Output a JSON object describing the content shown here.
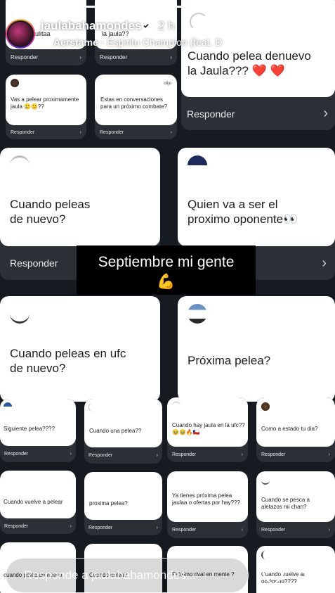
{
  "header": {
    "username": "jaulabahamondes",
    "time_ago": "2 h",
    "music_artist": "Aerstame",
    "music_separator": " · ",
    "music_song": "Espiritu Champion (feat. D",
    "progress_fraction": 0.66
  },
  "caption": {
    "line1": "Septiembre mi gente",
    "emoji": "💪"
  },
  "reply_label": "Responder",
  "reply_input": {
    "placeholder": "Responde a jaulabahamondes..."
  },
  "cards": {
    "r1a": {
      "text_l1": "",
      "text_l2": "jaulitaa",
      "tag": ""
    },
    "r1b": {
      "text_l1": "",
      "text_l2": "la jaula??",
      "tag": ""
    },
    "r1c": {
      "text_l1": "Cuando pelea denuevo",
      "text_l2": "la Jaula??? ❤️ ❤️"
    },
    "r2a": {
      "text": "Vas a pelear proximamente jaula 🥲😕??"
    },
    "r2b": {
      "text": "Estas en conversaciones para un próximo combate?",
      "tag": "olijo"
    },
    "big1": {
      "text_l1": "Cuando peleas",
      "text_l2": "de nuevo?"
    },
    "big2": {
      "text_l1": "Quien va a ser el",
      "text_l2": "proximo oponente👀"
    },
    "big3": {
      "text_l1": "Cuando peleas en ufc",
      "text_l2": "de nuevo?"
    },
    "big4": {
      "text_l1": "Próxima pelea?"
    },
    "s1": {
      "text": "Siguiente pelea????"
    },
    "s2": {
      "text": "Cuando una pelea??"
    },
    "s3": {
      "text": "Cuando hay jaula en la ufc??🥹🥹🔥🇨🇱"
    },
    "s4": {
      "text": "Como a estado tu dia?"
    },
    "s5": {
      "text": "Cuando vuelve a pelear"
    },
    "s6": {
      "text": "proxima pelea?"
    },
    "s7": {
      "text": "Ya tienes próxima pelea jaulaa o ofertas por hay???"
    },
    "s8": {
      "text": "Cuando se pesca a aletazos mi chan?"
    },
    "s9": {
      "text": "cuando pelea de nuevo"
    },
    "s10": {
      "text": "Cuando pelea?"
    },
    "s11": {
      "text": "Próximo rival en mente ?"
    },
    "s12": {
      "text": "Cuando vuelve al octágono????"
    }
  },
  "icons": {
    "mute": "speaker-muted-icon",
    "play": "play-icon",
    "more": "more-dots-icon",
    "heart": "heart-icon",
    "send": "send-icon",
    "verified": "verified-badge-icon",
    "music": "music-note-icon"
  },
  "colors": {
    "background": "#151b20",
    "card_bottom": "#2b3036",
    "card_top": "#ffffff",
    "verified": "#ffffff"
  }
}
